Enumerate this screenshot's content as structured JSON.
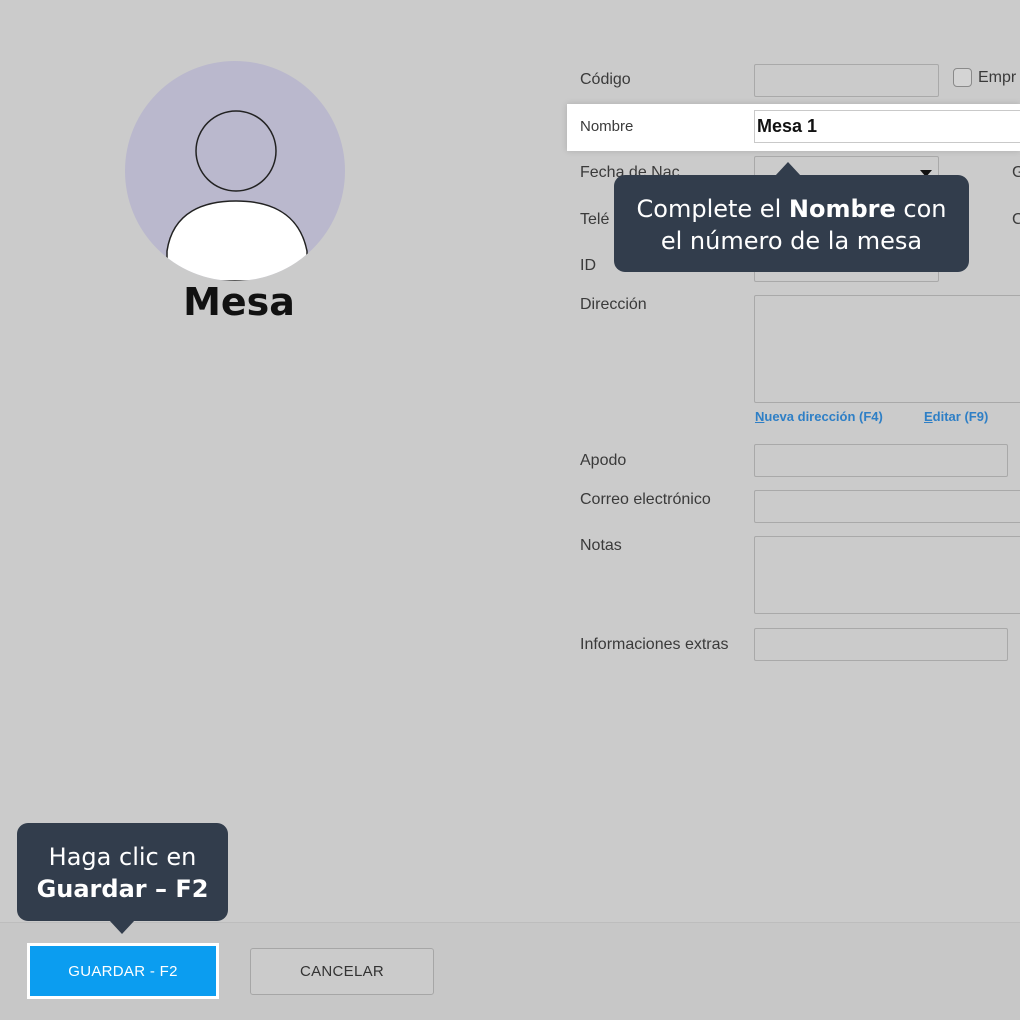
{
  "profile": {
    "title": "Mesa",
    "avatar_icon": "user-silhouette-icon",
    "avatar_bg": "#bab8cd"
  },
  "form": {
    "codigo_label": "Código",
    "codigo_value": "",
    "empresa_label": "Empr",
    "nombre_label": "Nombre",
    "nombre_value": "Mesa 1",
    "fecha_label": "Fecha de Nac",
    "side_label_1": "G",
    "telefono_label": "Telé",
    "side_label_2": "C",
    "id_label": "ID",
    "direccion_label": "Dirección",
    "nueva_direccion_link": "ueva dirección (F4)",
    "nueva_direccion_accesskey": "N",
    "editar_link": "ditar (F9)",
    "editar_accesskey": "E",
    "apodo_label": "Apodo",
    "correo_label": "Correo electrónico",
    "notas_label": "Notas",
    "extras_label": "Informaciones extras"
  },
  "tooltips": {
    "nombre_pre": "Complete el ",
    "nombre_bold": "Nombre",
    "nombre_post": " con",
    "nombre_line2": "el número de la mesa",
    "guardar_line1": "Haga clic en",
    "guardar_bold": "Guardar – F2"
  },
  "buttons": {
    "save_label": "GUARDAR - F2",
    "cancel_label": "CANCELAR"
  },
  "colors": {
    "primary": "#0b9df0",
    "tooltip_bg": "#323d4c",
    "link": "#2e7fc6",
    "background": "#cbcbcb"
  }
}
